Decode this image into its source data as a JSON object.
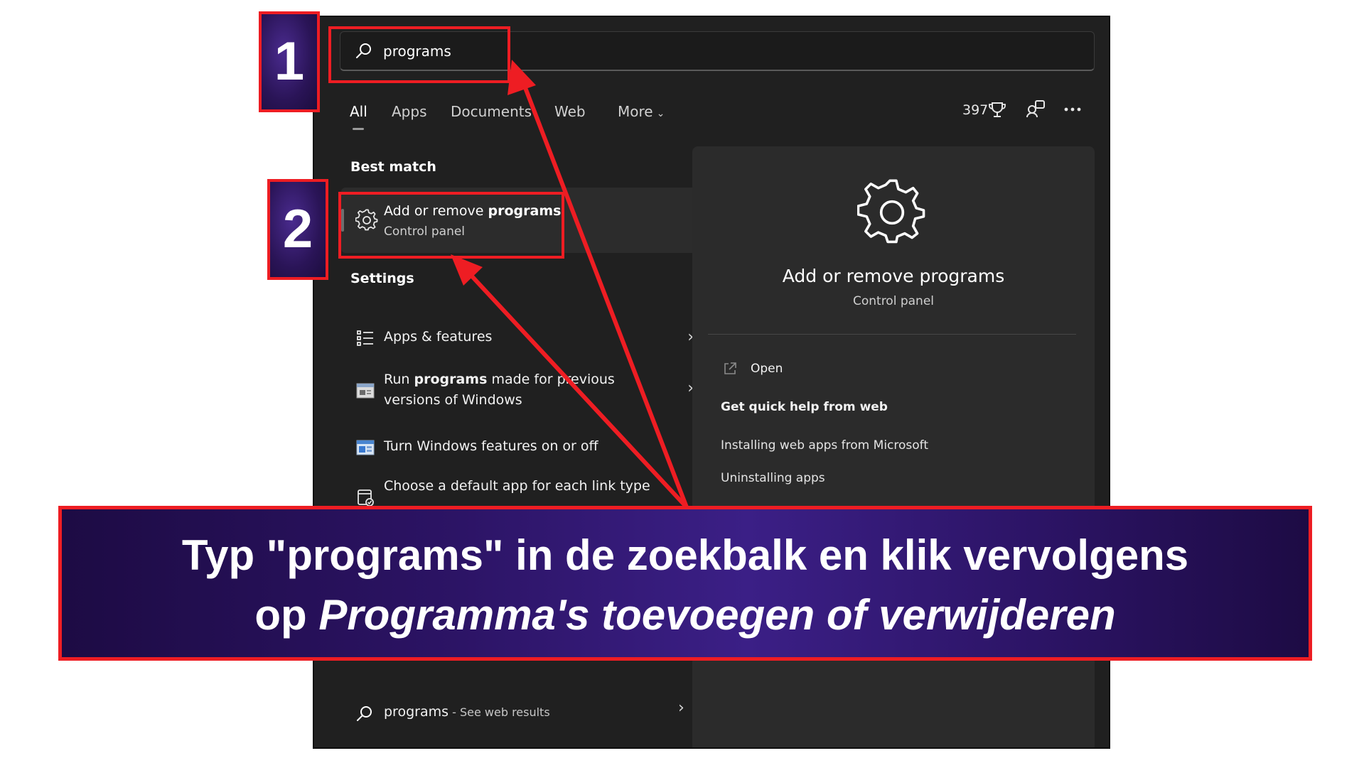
{
  "search": {
    "query": "programs"
  },
  "tabs": [
    {
      "label": "All",
      "active": true
    },
    {
      "label": "Apps"
    },
    {
      "label": "Documents"
    },
    {
      "label": "Web"
    },
    {
      "label": "More"
    }
  ],
  "toolbar": {
    "points": "397",
    "icons": [
      "trophy-icon",
      "switch-account-icon",
      "more-options-icon"
    ]
  },
  "best_match": {
    "heading": "Best match",
    "title_prefix": "Add or remove ",
    "title_bold": "programs",
    "subtitle": "Control panel",
    "icon": "gear-icon"
  },
  "settings": {
    "heading": "Settings",
    "items": [
      {
        "pre": "",
        "bold": "",
        "post": "Apps & features",
        "icon": "list-icon"
      },
      {
        "pre": "Run ",
        "bold": "programs",
        "post": " made for previous versions of Windows",
        "icon": "compat-window-icon"
      },
      {
        "pre": "",
        "bold": "",
        "post": "Turn Windows features on or off",
        "icon": "windows-features-icon"
      },
      {
        "pre": "",
        "bold": "",
        "post": "Choose a default app for each link type",
        "icon": "default-app-icon"
      }
    ]
  },
  "web_search": {
    "query": "programs",
    "suffix": " - See web results"
  },
  "detail": {
    "title": "Add or remove programs",
    "subtitle": "Control panel",
    "open_label": "Open",
    "help_title": "Get quick help from web",
    "help_links": [
      "Installing web apps from Microsoft",
      "Uninstalling apps"
    ]
  },
  "annotations": {
    "step1": "1",
    "step2": "2",
    "caption_line1": "Typ \"programs\" in de zoekbalk en klik vervolgens",
    "caption_line2_prefix": "op ",
    "caption_line2_italic": "Programma's toevoegen of verwijderen",
    "highlight_color": "#ee1d23",
    "caption_color": "#2b1363"
  }
}
